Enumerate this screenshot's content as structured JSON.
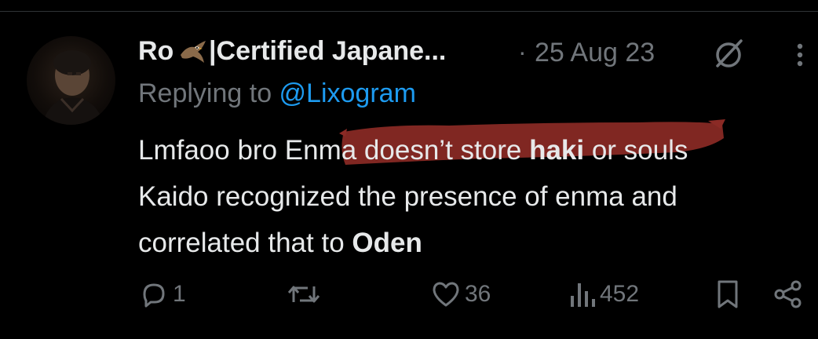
{
  "tweet": {
    "display_name_prefix": "Ro",
    "display_name_suffix": "|Certified Japane...",
    "separator": "·",
    "timestamp": "25 Aug 23",
    "replying_prefix": "Replying to ",
    "replying_handle": "@Lixogram",
    "body": {
      "line1_a": "Lmfaoo bro Enma doesn’t store ",
      "line1_bold": "haki",
      "line1_b": " or souls",
      "line2": "Kaido recognized the presence of enma and",
      "line3_a": "correlated that to ",
      "line3_bold": "Oden"
    },
    "highlight_color": "#8b2a25"
  },
  "actions": {
    "replies": "1",
    "retweets": "",
    "likes": "36",
    "views": "452"
  },
  "colors": {
    "background": "#000000",
    "text": "#e7e9ea",
    "muted": "#71767b",
    "accent": "#1d9bf0"
  },
  "icons": [
    "grok-icon",
    "more-icon",
    "reply-icon",
    "retweet-icon",
    "like-icon",
    "views-icon",
    "bookmark-icon",
    "share-icon"
  ]
}
